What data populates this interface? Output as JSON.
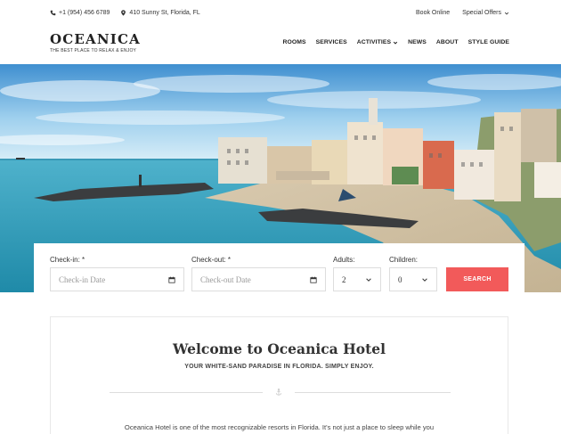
{
  "topbar": {
    "phone": "+1 (954) 456 6789",
    "address": "410 Sunny St, Florida, FL",
    "book_online": "Book Online",
    "special_offers": "Special Offers"
  },
  "logo": {
    "name": "OCEANICA",
    "tagline": "THE BEST PLACE TO RELAX & ENJOY"
  },
  "nav": {
    "items": [
      "ROOMS",
      "SERVICES",
      "ACTIVITIES",
      "NEWS",
      "ABOUT",
      "STYLE GUIDE"
    ]
  },
  "booking": {
    "checkin_label": "Check-in:",
    "checkin_placeholder": "Check-in Date",
    "checkout_label": "Check-out:",
    "checkout_placeholder": "Check-out Date",
    "required_mark": "*",
    "adults_label": "Adults:",
    "adults_value": "2",
    "children_label": "Children:",
    "children_value": "0",
    "search_label": "SEARCH"
  },
  "welcome": {
    "title": "Welcome to Oceanica Hotel",
    "subtitle": "YOUR WHITE-SAND PARADISE IN FLORIDA. SIMPLY ENJOY.",
    "body": "Oceanica Hotel is one of the most recognizable resorts in Florida. It's not just a place to sleep while you"
  },
  "colors": {
    "accent": "#f25a5a",
    "sea": "#3ba8c4",
    "sky": "#7ec4e6"
  },
  "icons": [
    "phone-icon",
    "map-pin-icon",
    "chevron-down-icon",
    "calendar-icon",
    "anchor-icon"
  ]
}
